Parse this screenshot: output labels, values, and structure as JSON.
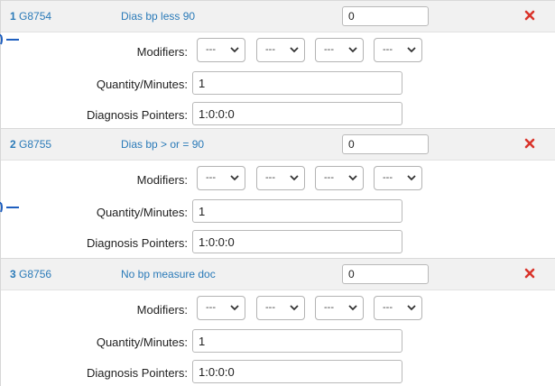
{
  "labels": {
    "modifiers": "Modifiers:",
    "quantity": "Quantity/Minutes:",
    "diagnosis": "Diagnosis Pointers:"
  },
  "colors": {
    "link": "#2a7ab8",
    "delete": "#d9342b",
    "header_bg": "#f1f1f1",
    "marker": "#1f5fbf"
  },
  "icons": {
    "delete": "close-icon",
    "select": "chevron-down-icon"
  },
  "items": [
    {
      "num": "1",
      "code": "G8754",
      "description": "Dias bp less 90",
      "units": "0",
      "modifiers": [
        "---",
        "---",
        "---",
        "---"
      ],
      "quantity": "1",
      "diagnosis_pointers": "1:0:0:0"
    },
    {
      "num": "2",
      "code": "G8755",
      "description": "Dias bp > or = 90",
      "units": "0",
      "modifiers": [
        "---",
        "---",
        "---",
        "---"
      ],
      "quantity": "1",
      "diagnosis_pointers": "1:0:0:0"
    },
    {
      "num": "3",
      "code": "G8756",
      "description": "No bp measure doc",
      "units": "0",
      "modifiers": [
        "---",
        "---",
        "---",
        "---"
      ],
      "quantity": "1",
      "diagnosis_pointers": "1:0:0:0"
    }
  ]
}
